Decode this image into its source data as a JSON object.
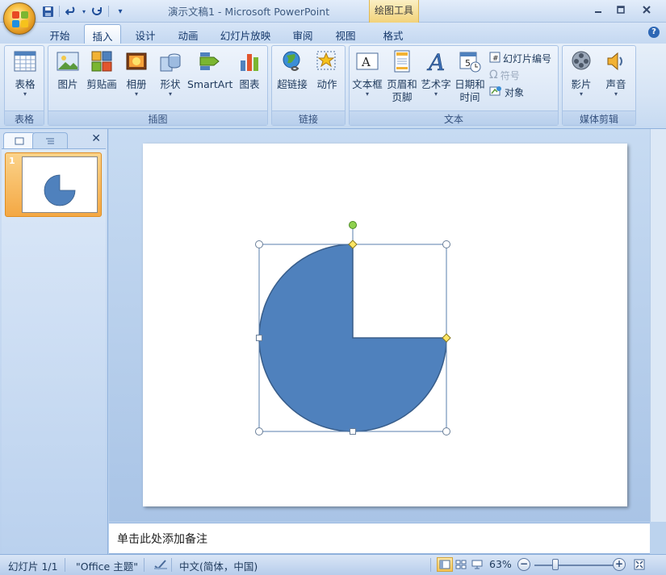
{
  "window": {
    "title": "演示文稿1 - Microsoft PowerPoint",
    "context_tab": "绘图工具"
  },
  "qat": {
    "icons": [
      "save-icon",
      "undo-icon",
      "redo-icon",
      "customize-qat-icon"
    ]
  },
  "tabs": [
    {
      "label": "开始"
    },
    {
      "label": "插入",
      "active": true
    },
    {
      "label": "设计"
    },
    {
      "label": "动画"
    },
    {
      "label": "幻灯片放映"
    },
    {
      "label": "审阅"
    },
    {
      "label": "视图"
    },
    {
      "label": "格式"
    }
  ],
  "ribbon": {
    "groups": {
      "tables": "表格",
      "illustrations": "插图",
      "links": "链接",
      "text": "文本",
      "media": "媒体剪辑"
    },
    "buttons": {
      "table": "表格",
      "picture": "图片",
      "clipart": "剪贴画",
      "album": "相册",
      "shapes": "形状",
      "smartart": "SmartArt",
      "chart": "图表",
      "hyperlink": "超链接",
      "action": "动作",
      "textbox": "文本框",
      "header_footer_1": "页眉和",
      "header_footer_2": "页脚",
      "wordart": "艺术字",
      "datetime_1": "日期和",
      "datetime_2": "时间",
      "slide_number": "幻灯片编号",
      "symbol": "符号",
      "object": "对象",
      "movie": "影片",
      "sound": "声音"
    }
  },
  "slide_pane": {
    "slide_number": "1"
  },
  "notes": {
    "placeholder": "单击此处添加备注"
  },
  "status": {
    "slide_info": "幻灯片 1/1",
    "theme": "\"Office 主题\"",
    "language": "中文(简体，中国)",
    "zoom": "63%",
    "zoom_percent": 63
  },
  "colors": {
    "shape_fill": "#4f81bd",
    "shape_stroke": "#385d8a",
    "selection_handle": "#ffffff",
    "adjust_handle": "#ffe664",
    "rotate_handle": "#8fd14f"
  }
}
